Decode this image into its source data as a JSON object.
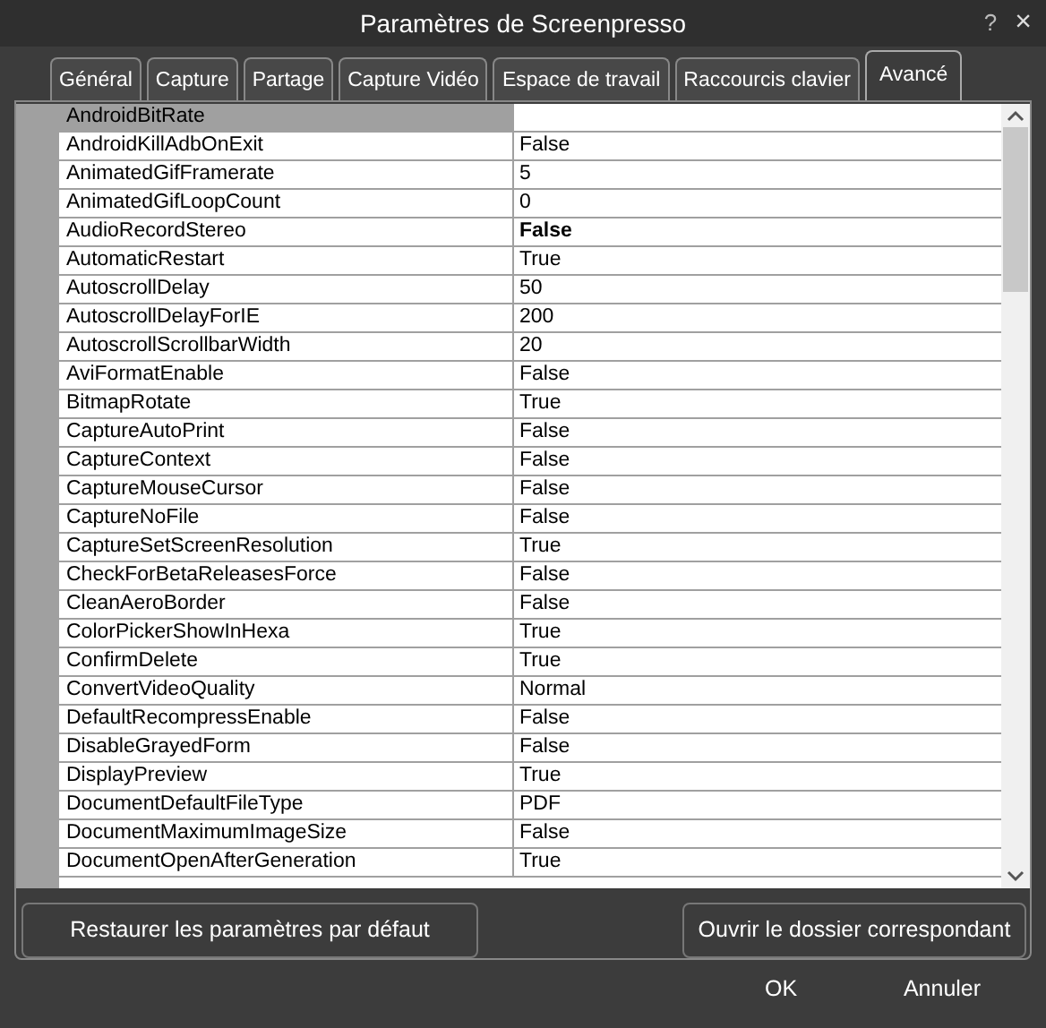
{
  "window": {
    "title": "Paramètres de Screenpresso",
    "help": "?",
    "close": "×"
  },
  "tabs": [
    {
      "label": "Général",
      "selected": false
    },
    {
      "label": "Capture",
      "selected": false
    },
    {
      "label": "Partage",
      "selected": false
    },
    {
      "label": "Capture Vidéo",
      "selected": false
    },
    {
      "label": "Espace de travail",
      "selected": false
    },
    {
      "label": "Raccourcis clavier",
      "selected": false
    },
    {
      "label": "Avancé",
      "selected": true
    }
  ],
  "properties": [
    {
      "name": "AndroidBitRate",
      "selected": true,
      "modified": false
    },
    {
      "name": "AndroidKillAdbOnExit",
      "value": "False",
      "selected": false,
      "modified": false
    },
    {
      "name": "AnimatedGifFramerate",
      "value": "5",
      "selected": false,
      "modified": false
    },
    {
      "name": "AnimatedGifLoopCount",
      "value": "0",
      "selected": false,
      "modified": false
    },
    {
      "name": "AudioRecordStereo",
      "value": "False",
      "selected": false,
      "modified": true
    },
    {
      "name": "AutomaticRestart",
      "value": "True",
      "selected": false,
      "modified": false
    },
    {
      "name": "AutoscrollDelay",
      "value": "50",
      "selected": false,
      "modified": false
    },
    {
      "name": "AutoscrollDelayForIE",
      "value": "200",
      "selected": false,
      "modified": false
    },
    {
      "name": "AutoscrollScrollbarWidth",
      "value": "20",
      "selected": false,
      "modified": false
    },
    {
      "name": "AviFormatEnable",
      "value": "False",
      "selected": false,
      "modified": false
    },
    {
      "name": "BitmapRotate",
      "value": "True",
      "selected": false,
      "modified": false
    },
    {
      "name": "CaptureAutoPrint",
      "value": "False",
      "selected": false,
      "modified": false
    },
    {
      "name": "CaptureContext",
      "value": "False",
      "selected": false,
      "modified": false
    },
    {
      "name": "CaptureMouseCursor",
      "value": "False",
      "selected": false,
      "modified": false
    },
    {
      "name": "CaptureNoFile",
      "value": "False",
      "selected": false,
      "modified": false
    },
    {
      "name": "CaptureSetScreenResolution",
      "value": "True",
      "selected": false,
      "modified": false
    },
    {
      "name": "CheckForBetaReleasesForce",
      "value": "False",
      "selected": false,
      "modified": false
    },
    {
      "name": "CleanAeroBorder",
      "value": "False",
      "selected": false,
      "modified": false
    },
    {
      "name": "ColorPickerShowInHexa",
      "value": "True",
      "selected": false,
      "modified": false
    },
    {
      "name": "ConfirmDelete",
      "value": "True",
      "selected": false,
      "modified": false
    },
    {
      "name": "ConvertVideoQuality",
      "value": "Normal",
      "selected": false,
      "modified": false
    },
    {
      "name": "DefaultRecompressEnable",
      "value": "False",
      "selected": false,
      "modified": false
    },
    {
      "name": "DisableGrayedForm",
      "value": "False",
      "selected": false,
      "modified": false
    },
    {
      "name": "DisplayPreview",
      "value": "True",
      "selected": false,
      "modified": false
    },
    {
      "name": "DocumentDefaultFileType",
      "value": "PDF",
      "selected": false,
      "modified": false
    },
    {
      "name": "DocumentMaximumImageSize",
      "value": "False",
      "selected": false,
      "modified": false
    },
    {
      "name": "DocumentOpenAfterGeneration",
      "value": "True",
      "selected": false,
      "modified": false
    }
  ],
  "panel_buttons": [
    "Restaurer les paramètres par défaut",
    "Ouvrir le dossier correspondant"
  ],
  "dialog_buttons": [
    "OK",
    "Annuler"
  ]
}
